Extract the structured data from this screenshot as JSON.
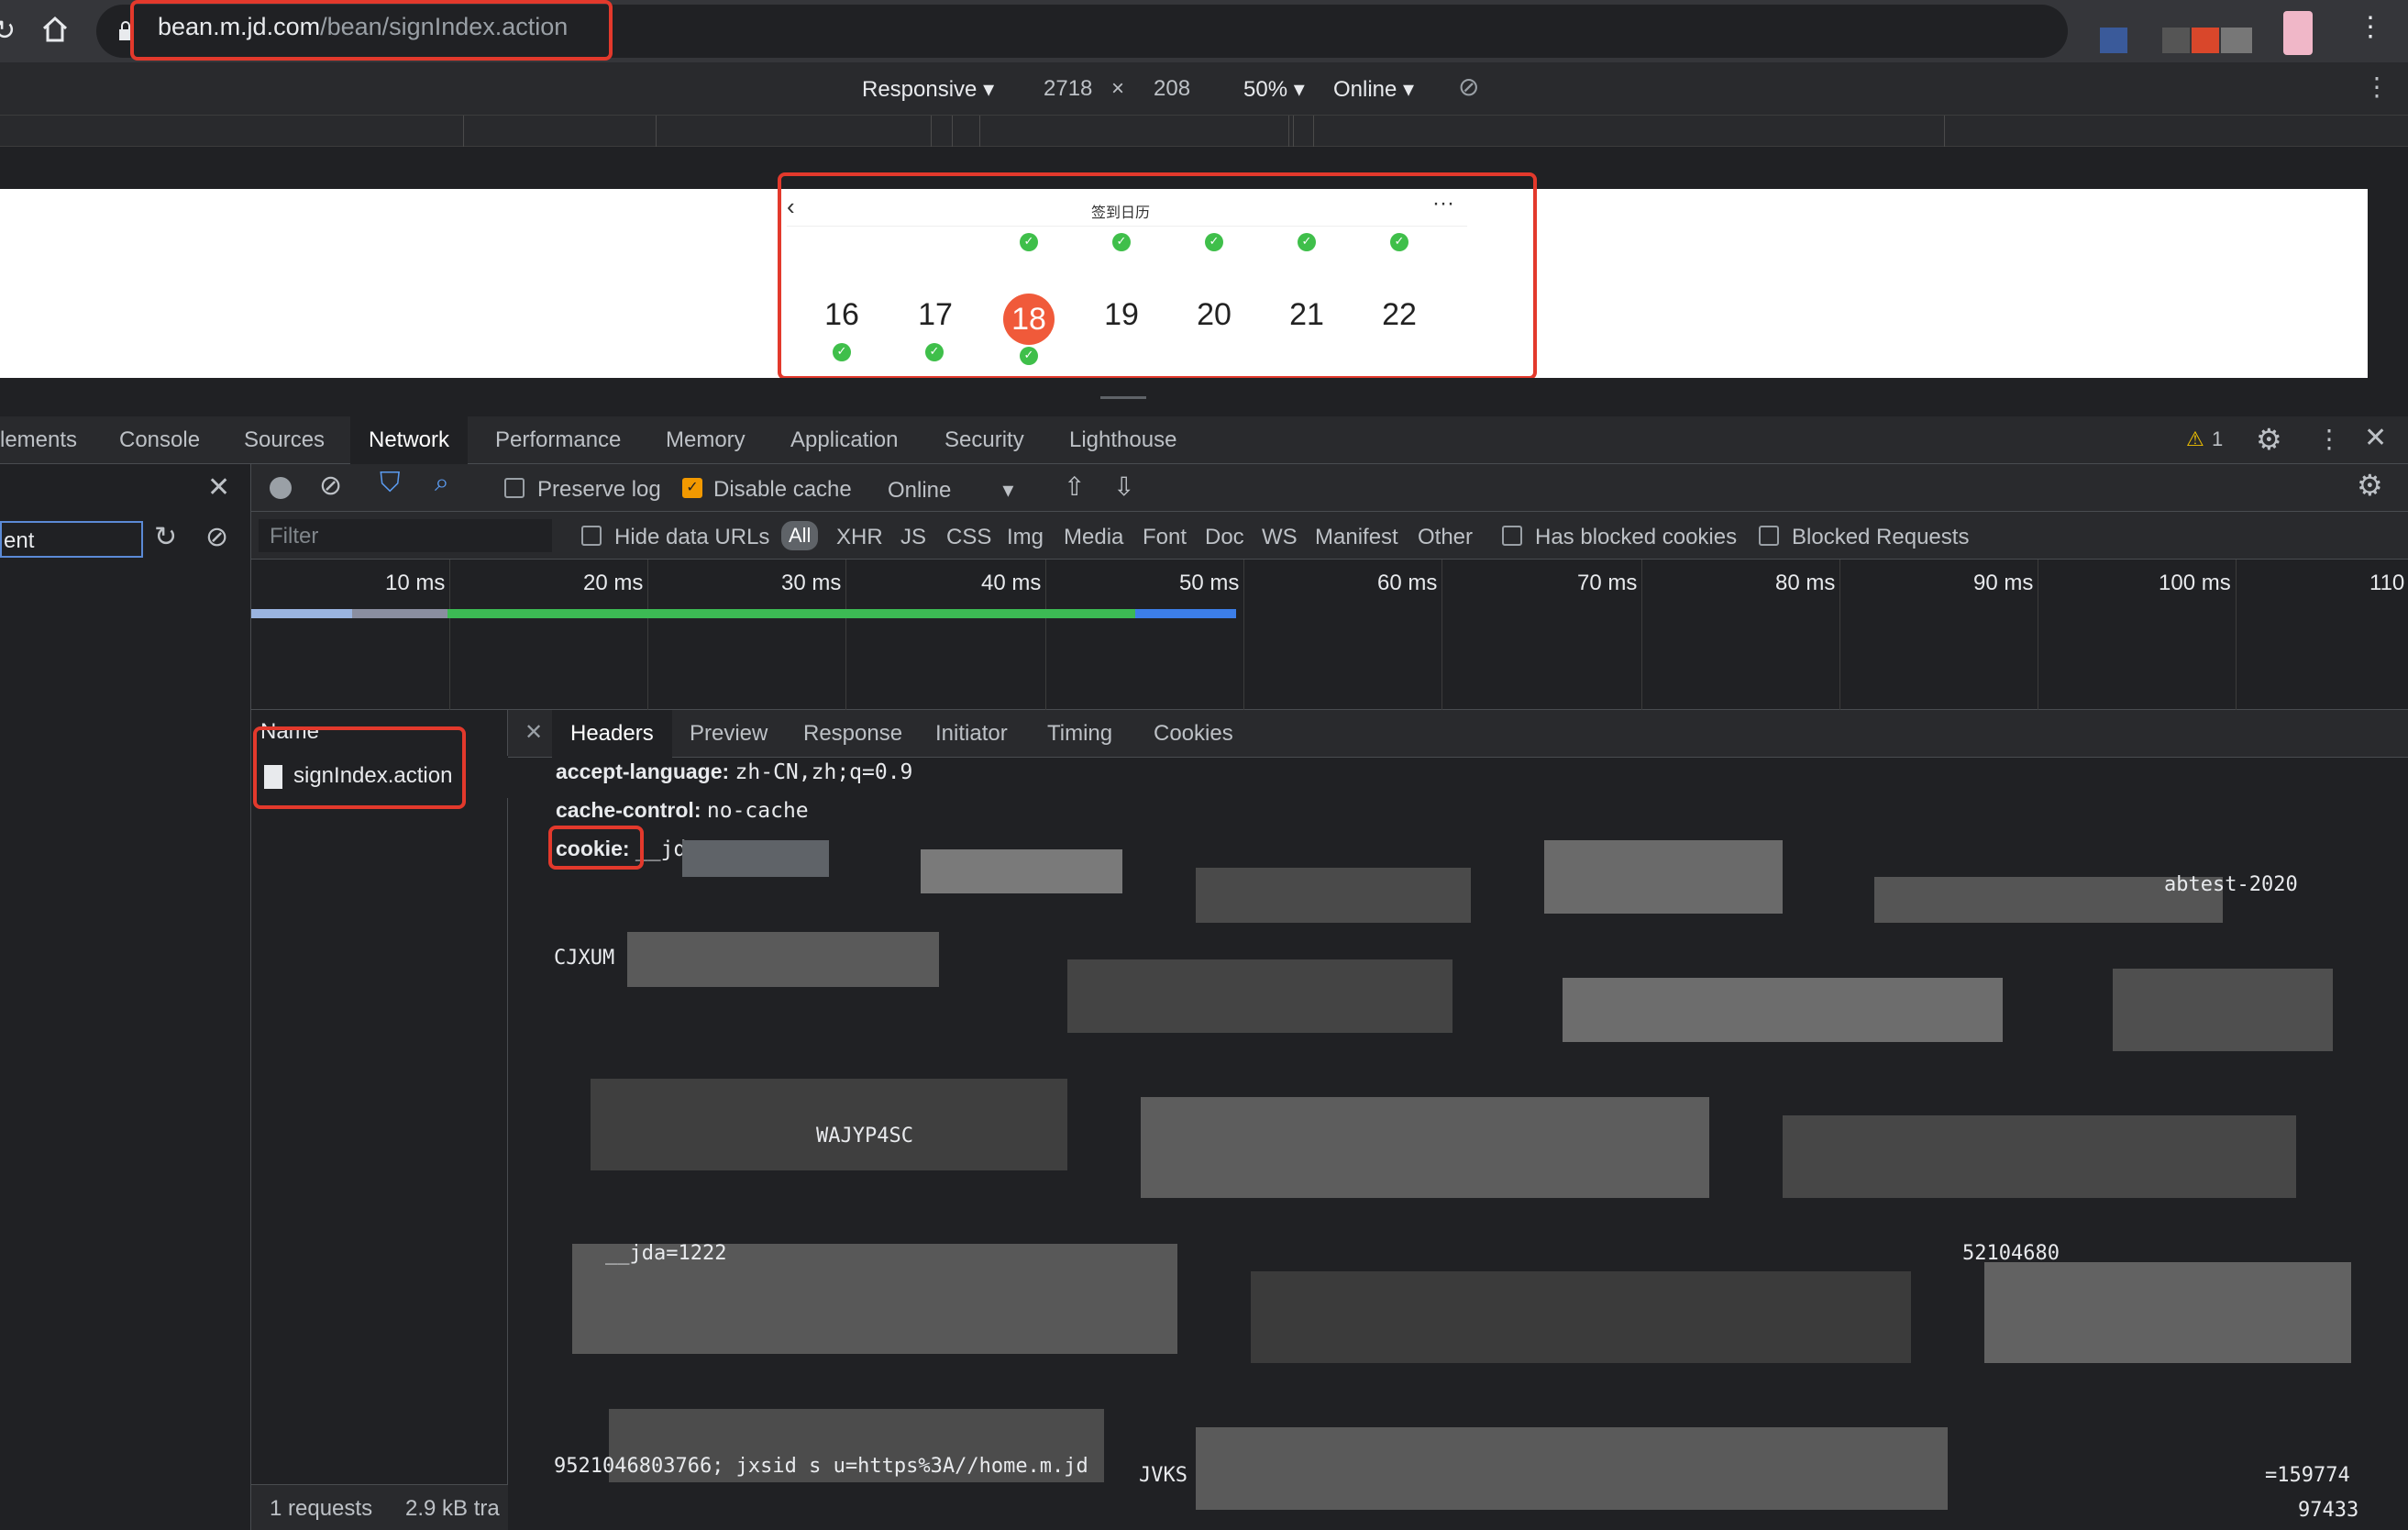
{
  "browser": {
    "url_host": "bean.m.jd.com",
    "url_path": "/bean/signIndex.action"
  },
  "device_toolbar": {
    "mode": "Responsive",
    "width": "2718",
    "times": "×",
    "height": "208",
    "zoom": "50%",
    "throttle": "Online"
  },
  "page": {
    "title": "签到日历",
    "more": "···",
    "back": "‹",
    "days": [
      "16",
      "17",
      "18",
      "19",
      "20",
      "21",
      "22"
    ],
    "today": "18"
  },
  "devtools": {
    "tabs": [
      "lements",
      "Console",
      "Sources",
      "Network",
      "Performance",
      "Memory",
      "Application",
      "Security",
      "Lighthouse"
    ],
    "active_tab": "Network",
    "warning_count": "1",
    "toolbar": {
      "preserve_log": "Preserve log",
      "disable_cache": "Disable cache",
      "throttle": "Online"
    },
    "left_input": "ent",
    "filter_placeholder": "Filter",
    "hide_data_urls": "Hide data URLs",
    "types": [
      "All",
      "XHR",
      "JS",
      "CSS",
      "Img",
      "Media",
      "Font",
      "Doc",
      "WS",
      "Manifest",
      "Other"
    ],
    "has_blocked_cookies": "Has blocked cookies",
    "blocked_requests": "Blocked Requests",
    "timeline_labels": [
      "10 ms",
      "20 ms",
      "30 ms",
      "40 ms",
      "50 ms",
      "60 ms",
      "70 ms",
      "80 ms",
      "90 ms",
      "100 ms",
      "110"
    ],
    "name_header": "Name",
    "request_name": "signIndex.action",
    "status": {
      "requests": "1 requests",
      "transferred": "2.9 kB tra"
    },
    "detail_tabs": [
      "Headers",
      "Preview",
      "Response",
      "Initiator",
      "Timing",
      "Cookies"
    ],
    "active_detail_tab": "Headers",
    "headers": [
      {
        "name": "accept-language:",
        "value": "zh-CN,zh;q=0.9"
      },
      {
        "name": "cache-control:",
        "value": "no-cache"
      },
      {
        "name": "cookie:",
        "value": "__jda="
      }
    ],
    "cookie_fragments": [
      "abtest-2020",
      "CJXUM",
      "WAJYP4SC",
      "__jda=1222",
      "9521046803766; jxsid s u=https%3A//home.m.jd",
      "52104680",
      "JVKS",
      "=159774",
      "97433"
    ]
  },
  "colors": {
    "highlight": "#e3392c",
    "today": "#f05a3a",
    "check": "#3fbf4a",
    "active_tab_bg": "#202124"
  }
}
